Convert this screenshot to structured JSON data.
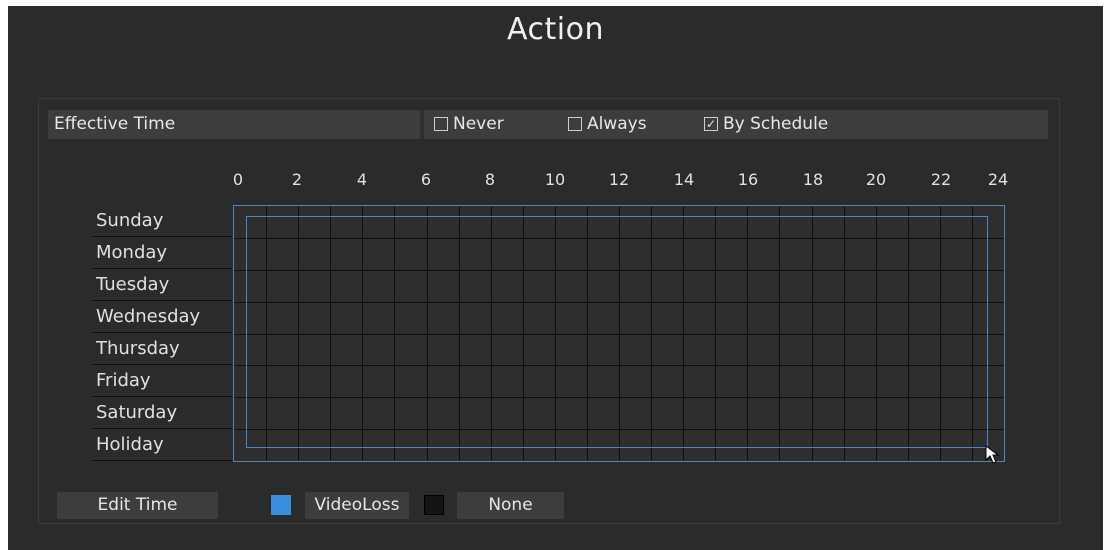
{
  "window": {
    "title": "Action"
  },
  "effective_time": {
    "label": "Effective Time",
    "options": [
      {
        "label": "Never",
        "checked": false
      },
      {
        "label": "Always",
        "checked": false
      },
      {
        "label": "By Schedule",
        "checked": true
      }
    ]
  },
  "schedule": {
    "hour_labels": [
      "0",
      "2",
      "4",
      "6",
      "8",
      "10",
      "12",
      "14",
      "16",
      "18",
      "20",
      "22",
      "24"
    ],
    "days": [
      "Sunday",
      "Monday",
      "Tuesday",
      "Wednesday",
      "Thursday",
      "Friday",
      "Saturday",
      "Holiday"
    ]
  },
  "footer": {
    "edit_time_label": "Edit Time",
    "legend": [
      {
        "label": "VideoLoss",
        "color": "#3a8ee0"
      },
      {
        "label": "None",
        "color": "#141414"
      }
    ]
  },
  "colors": {
    "background": "#2b2b2b",
    "bar": "#3d3d3d",
    "accent": "#4a86c5"
  },
  "icons": {
    "checkbox_checked": "check-icon",
    "pointer": "mouse-pointer-icon"
  }
}
